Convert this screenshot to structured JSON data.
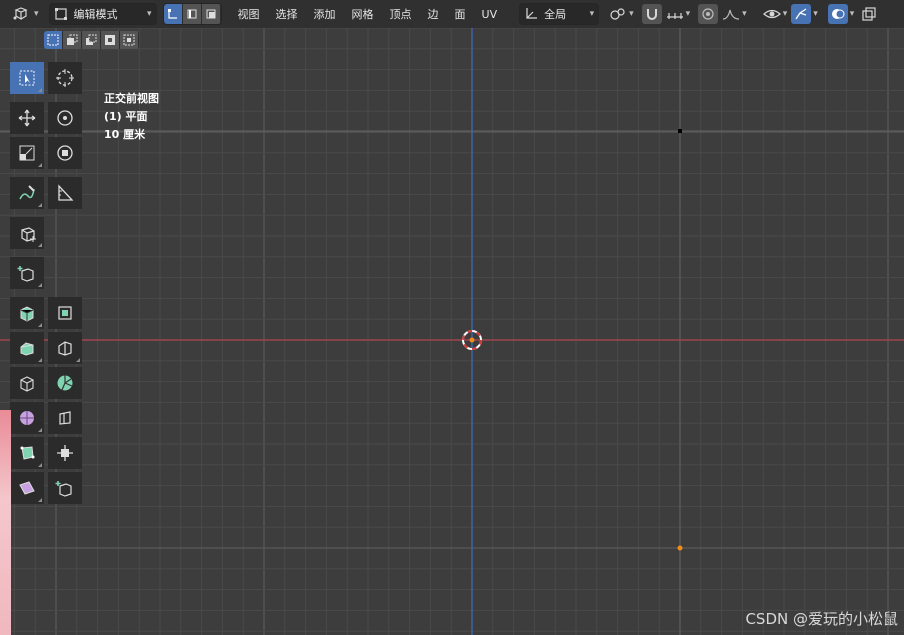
{
  "header": {
    "mode_label": "编辑模式",
    "menus": [
      "视图",
      "选择",
      "添加",
      "网格",
      "顶点",
      "边",
      "面",
      "UV"
    ],
    "transform_orientation": "全局"
  },
  "viewport": {
    "view_name": "正交前视图",
    "object_info": "(1) 平面",
    "scale_info": "10 厘米"
  },
  "watermark": "CSDN @爱玩的小松鼠",
  "colors": {
    "x_axis": "#b0424e",
    "z_axis": "#3c66b8",
    "selected_edge": "#f08c1a",
    "active_tool": "#4772b3"
  },
  "toolbar": {
    "icons": [
      "select-box-icon",
      "cursor-icon",
      "move-icon",
      "rotate-icon",
      "scale-icon",
      "transform-icon",
      "annotate-icon",
      "measure-icon",
      "add-cube-icon",
      "extrude-region-icon",
      "inset-faces-icon",
      "bevel-icon",
      "loop-cut-icon",
      "knife-icon",
      "poly-build-icon",
      "spin-icon",
      "smooth-icon",
      "edge-slide-icon",
      "shrink-fatten-icon",
      "shear-icon",
      "rip-region-icon"
    ]
  }
}
